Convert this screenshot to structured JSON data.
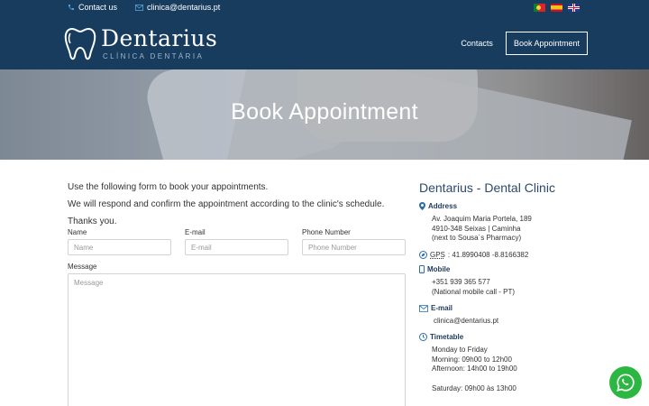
{
  "topbar": {
    "contact_label": "Contact us",
    "email": "clinica@dentarius.pt",
    "languages": [
      "pt",
      "es",
      "en"
    ]
  },
  "brand": {
    "name": "Dentarius",
    "tagline": "CLÍNICA DENTÁRIA",
    "colors": {
      "header_bg": "#173c5e",
      "accent": "#2b4a6b",
      "whatsapp": "#2cb742"
    }
  },
  "nav": {
    "contacts_label": "Contacts",
    "book_label": "Book Appointment"
  },
  "hero": {
    "title": "Book Appointment"
  },
  "intro": {
    "line1": "Use the following form to book your appointments.",
    "line2": "We will respond and confirm the appointment according to the clinic's schedule.",
    "line3": "Thanks you."
  },
  "form": {
    "name_label": "Name",
    "name_placeholder": "Name",
    "email_label": "E-mail",
    "email_placeholder": "E-mail",
    "phone_label": "Phone Number",
    "phone_placeholder": "Phone Number",
    "message_label": "Message",
    "message_placeholder": "Message"
  },
  "sidebar": {
    "title": "Dentarius - Dental Clinic",
    "address_label": "Address",
    "address_line1": "Av. Joaquim Maria Portela, 189",
    "address_line2": "4910-348 Seixas | Caminha",
    "address_line3": "(next to Sousa´s Pharmacy)",
    "gps_label": "GPS",
    "gps_value": ": 41.8990408 -8.8166382",
    "mobile_label": "Mobile",
    "mobile_number": "+351 939 365 577",
    "mobile_note": "(National mobile call - PT)",
    "email_label": "E-mail",
    "email_value": "clinica@dentarius.pt",
    "timetable_label": "Timetable",
    "timetable_days": "Monday to Friday",
    "timetable_morning": "Morning: 09h00 to 12h00",
    "timetable_afternoon": "Afternoon: 14h00 to 19h00",
    "timetable_saturday": "Saturday: 09h00 às 13h00"
  },
  "icons": [
    "phone-icon",
    "mail-icon",
    "tooth-logo-icon",
    "map-pin-icon",
    "gps-icon",
    "mobile-icon",
    "envelope-icon",
    "clock-icon",
    "whatsapp-icon"
  ]
}
